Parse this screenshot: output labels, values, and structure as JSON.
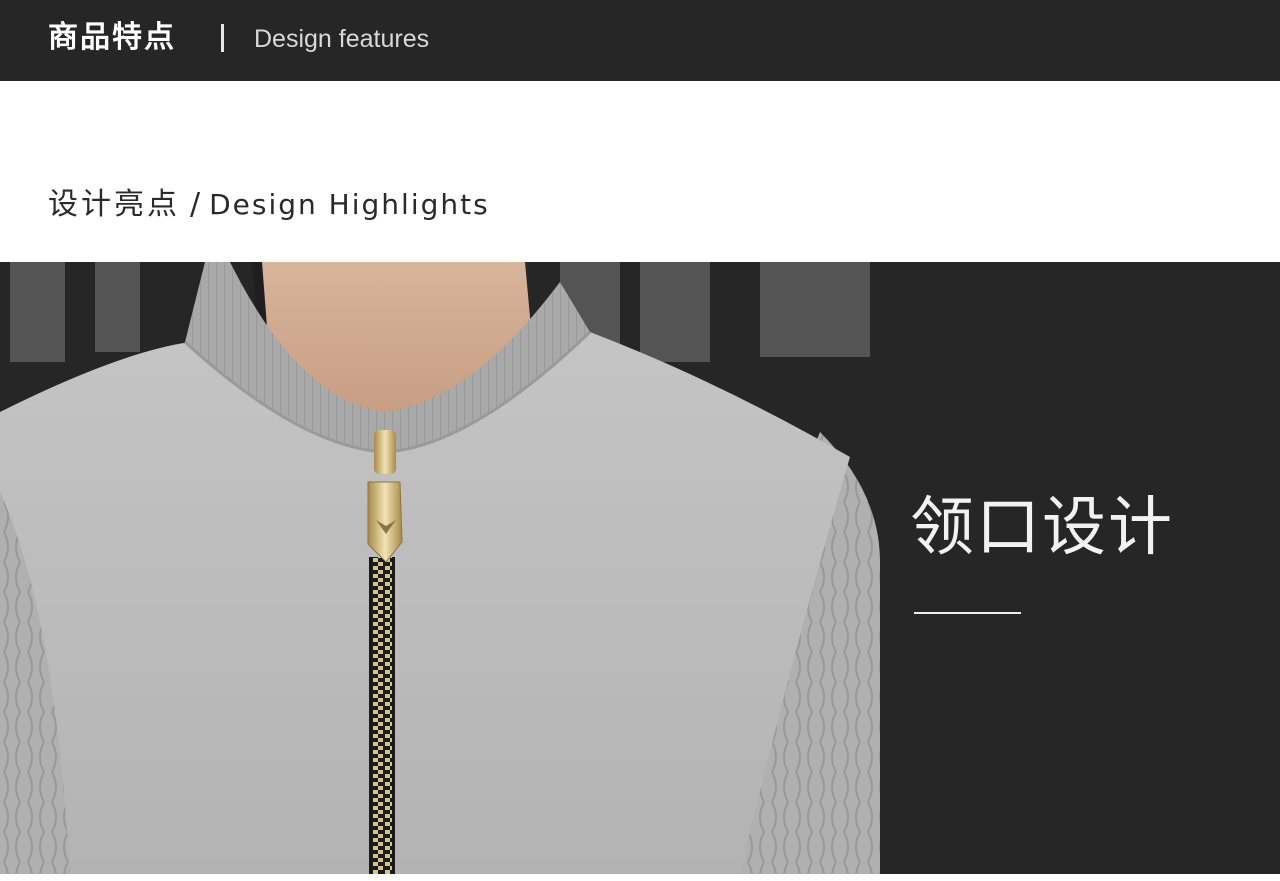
{
  "header": {
    "title_cn": "商品特点",
    "title_en": "Design features"
  },
  "section": {
    "title_cn": "设计亮点",
    "separator": "/",
    "title_en": "Design Highlights"
  },
  "feature": {
    "title": "领口设计"
  },
  "colors": {
    "dark_background": "#262626",
    "page_background": "#ffffff",
    "sweater_grey": "#b7b7b7"
  }
}
